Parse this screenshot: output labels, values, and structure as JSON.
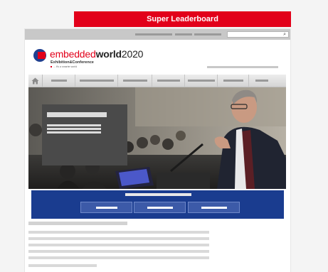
{
  "leaderboard": {
    "label": "Super Leaderboard"
  },
  "logo": {
    "word_part1": "embedded",
    "word_part2": "world",
    "year": "2020",
    "subtitle": "Exhibition&Conference",
    "tagline": "... it's a smarter world"
  },
  "search": {
    "icon": "search-icon",
    "icon_glyph": "⌕"
  },
  "nav": {
    "home_icon": "home-icon"
  },
  "colors": {
    "brand_red": "#e2001a",
    "brand_blue": "#1a3c8f",
    "nav_bg": "#dcdcdc"
  }
}
